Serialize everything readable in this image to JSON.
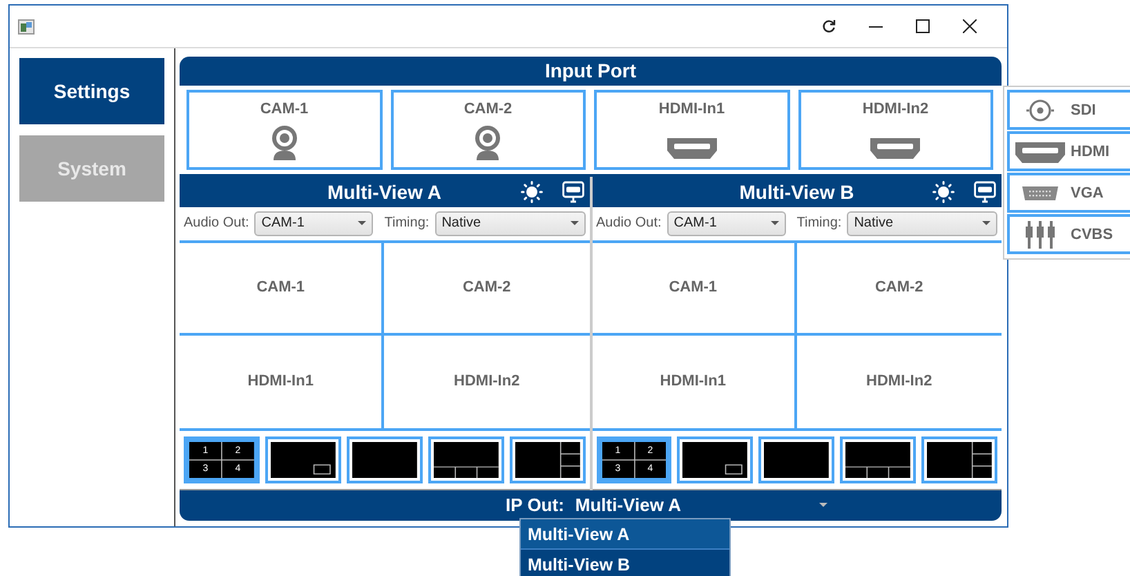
{
  "sidebar": {
    "items": [
      {
        "label": "Settings",
        "selected": true
      },
      {
        "label": "System",
        "selected": false
      }
    ]
  },
  "input_port": {
    "title": "Input Port",
    "inputs": [
      {
        "label": "CAM-1",
        "kind": "camera"
      },
      {
        "label": "CAM-2",
        "kind": "camera"
      },
      {
        "label": "HDMI-In1",
        "kind": "hdmi"
      },
      {
        "label": "HDMI-In2",
        "kind": "hdmi"
      }
    ]
  },
  "multiviews": [
    {
      "title": "Multi-View A",
      "audio_out": {
        "label": "Audio Out:",
        "value": "CAM-1"
      },
      "timing": {
        "label": "Timing:",
        "value": "Native"
      },
      "cells": [
        "CAM-1",
        "CAM-2",
        "HDMI-In1",
        "HDMI-In2"
      ],
      "layouts": [
        {
          "kind": "quad",
          "selected": true,
          "numbers": [
            "1",
            "2",
            "3",
            "4"
          ]
        },
        {
          "kind": "pip",
          "selected": false
        },
        {
          "kind": "single",
          "selected": false
        },
        {
          "kind": "main-bottom",
          "selected": false
        },
        {
          "kind": "main-side",
          "selected": false
        }
      ]
    },
    {
      "title": "Multi-View B",
      "audio_out": {
        "label": "Audio Out:",
        "value": "CAM-1"
      },
      "timing": {
        "label": "Timing:",
        "value": "Native"
      },
      "cells": [
        "CAM-1",
        "CAM-2",
        "HDMI-In1",
        "HDMI-In2"
      ],
      "layouts": [
        {
          "kind": "quad",
          "selected": true,
          "numbers": [
            "1",
            "2",
            "3",
            "4"
          ]
        },
        {
          "kind": "pip",
          "selected": false
        },
        {
          "kind": "single",
          "selected": false
        },
        {
          "kind": "main-bottom",
          "selected": false
        },
        {
          "kind": "main-side",
          "selected": false
        }
      ]
    }
  ],
  "ip_out": {
    "label": "IP Out:",
    "value": "Multi-View A",
    "options": [
      {
        "label": "Multi-View A",
        "selected": true
      },
      {
        "label": "Multi-View B",
        "selected": false
      }
    ]
  },
  "port_menu": [
    {
      "label": "SDI",
      "kind": "sdi"
    },
    {
      "label": "HDMI",
      "kind": "hdmi"
    },
    {
      "label": "VGA",
      "kind": "vga"
    },
    {
      "label": "CVBS",
      "kind": "cvbs"
    }
  ]
}
